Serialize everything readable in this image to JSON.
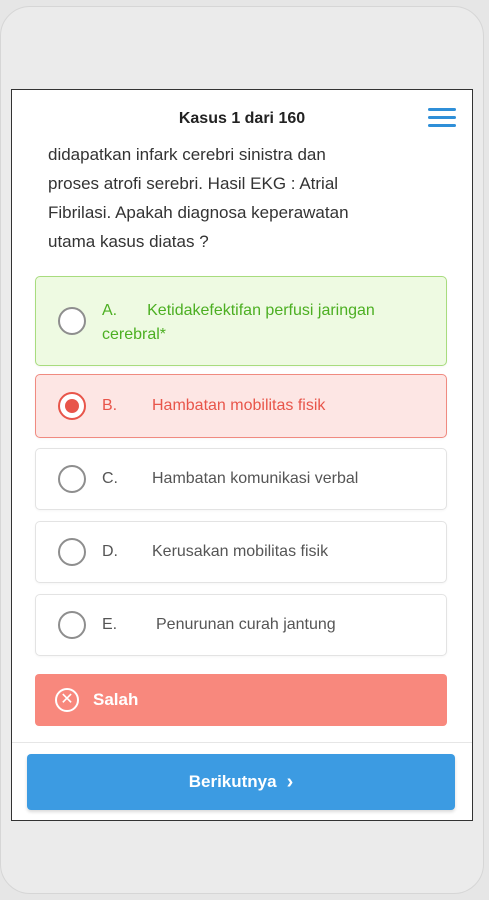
{
  "header": {
    "title": "Kasus 1 dari 160",
    "menu_icon": "hamburger-menu-icon"
  },
  "question": {
    "lines": [
      "didapatkan infark cerebri sinistra dan",
      "proses atrofi serebri. Hasil EKG : Atrial",
      "Fibrilasi. Apakah diagnosa keperawatan",
      "utama kasus diatas ?"
    ]
  },
  "options": [
    {
      "letter": "A.",
      "text": "Ketidakefektifan perfusi jaringan",
      "text2": "cerebral*",
      "state": "correct",
      "selected": false
    },
    {
      "letter": "B.",
      "text": "Hambatan mobilitas fisik",
      "state": "wrong",
      "selected": true
    },
    {
      "letter": "C.",
      "text": "Hambatan komunikasi verbal",
      "state": "neutral",
      "selected": false
    },
    {
      "letter": "D.",
      "text": "Kerusakan mobilitas fisik",
      "state": "neutral",
      "selected": false
    },
    {
      "letter": "E.",
      "text": "Penurunan curah jantung",
      "state": "neutral",
      "selected": false
    }
  ],
  "result": {
    "label": "Salah",
    "icon": "x-circle-icon"
  },
  "next_button": {
    "label": "Berikutnya",
    "icon": "chevron-right-icon"
  },
  "colors": {
    "accent": "#3c9be2",
    "correct": "#4caf22",
    "wrong": "#e8554a",
    "result_bg": "#f8887d"
  }
}
